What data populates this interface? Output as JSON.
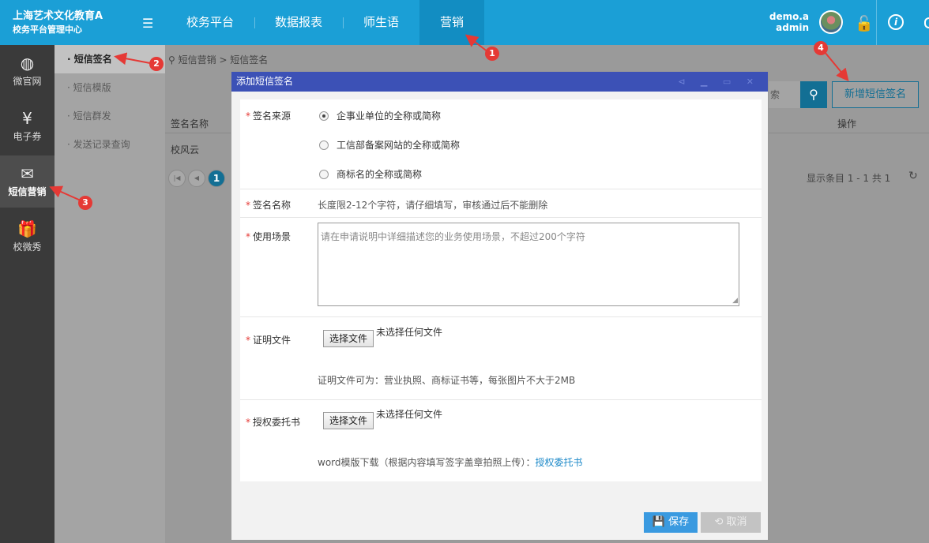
{
  "brand": {
    "line1": "上海艺术文化教育A",
    "line2": "校务平台管理中心"
  },
  "topnav": [
    {
      "label": "校务平台"
    },
    {
      "label": "数据报表"
    },
    {
      "label": "师生语"
    },
    {
      "label": "营销"
    }
  ],
  "user": {
    "name": "demo.a",
    "role": "admin"
  },
  "sidebar1": [
    {
      "label": "微官网",
      "icon": "globe-icon"
    },
    {
      "label": "电子券",
      "icon": "coupon-icon"
    },
    {
      "label": "短信营销",
      "icon": "sms-icon"
    },
    {
      "label": "校微秀",
      "icon": "gift-icon"
    }
  ],
  "sidebar2": [
    {
      "label": "· 短信签名"
    },
    {
      "label": "· 短信模版"
    },
    {
      "label": "· 短信群发"
    },
    {
      "label": "· 发送记录查询"
    }
  ],
  "breadcrumb": "短信营销 > 短信签名",
  "search_text": "索",
  "add_button": "新增短信签名",
  "table": {
    "headers": [
      "签名名称",
      "操作"
    ],
    "rows": [
      [
        "校风云"
      ]
    ]
  },
  "pager": {
    "current": "1",
    "info": "显示条目 1 - 1 共 1"
  },
  "modal": {
    "title": "添加短信签名",
    "source_label": "签名来源",
    "source_options": [
      "企事业单位的全称或简称",
      "工信部备案网站的全称或简称",
      "商标名的全称或简称"
    ],
    "name_label": "签名名称",
    "name_hint": "长度限2-12个字符，请仔细填写，审核通过后不能删除",
    "scene_label": "使用场景",
    "scene_placeholder": "请在申请说明中详细描述您的业务使用场景，不超过200个字符",
    "proof_label": "证明文件",
    "choose_file": "选择文件",
    "no_file": "未选择任何文件",
    "proof_hint": "证明文件可为：营业执照、商标证书等，每张图片不大于2MB",
    "auth_label": "授权委托书",
    "auth_hint": "word模版下载（根据内容填写签字盖章拍照上传）：",
    "auth_link": "授权委托书",
    "save": "保存",
    "cancel": "取消"
  },
  "annotations": [
    "1",
    "2",
    "3",
    "4"
  ],
  "colors": {
    "topbar": "#1b9fd6",
    "modal_title": "#3c51b6",
    "save": "#3a9ae0",
    "required": "#e53935"
  }
}
